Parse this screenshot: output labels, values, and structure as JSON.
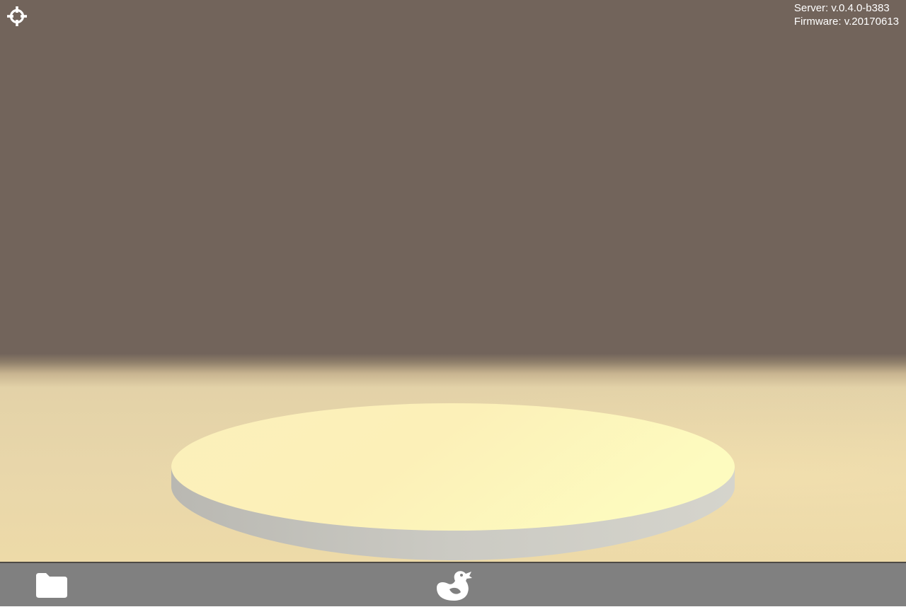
{
  "viewport": {
    "crosshair_icon": "crosshair-icon",
    "server_version": "Server: v.0.4.0-b383",
    "firmware_version": "Firmware: v.20170613",
    "platform_icon": "build-platform",
    "colors": {
      "background": "#72645b",
      "floor": "#e9d7aa",
      "platform_top": "#fdf6c0",
      "platform_side": "#c8c7c0"
    }
  },
  "bottom_bar": {
    "folder_icon": "folder-icon",
    "duck_icon": "duck-icon",
    "color": "#808080"
  }
}
